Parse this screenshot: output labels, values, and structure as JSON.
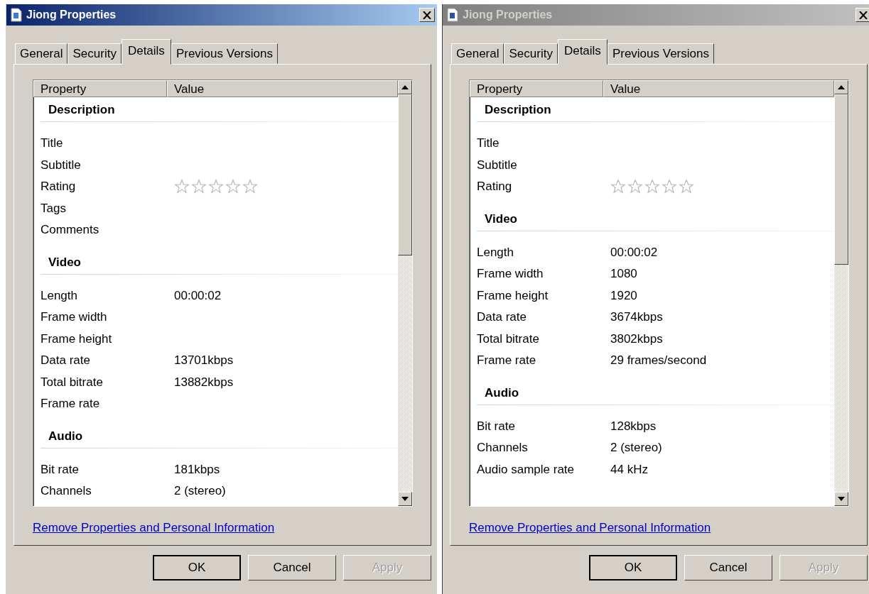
{
  "windows": [
    {
      "title": "Jiong Properties",
      "active": true,
      "tabs": [
        {
          "label": "General",
          "selected": false
        },
        {
          "label": "Security",
          "selected": false
        },
        {
          "label": "Details",
          "selected": true
        },
        {
          "label": "Previous Versions",
          "selected": false
        }
      ],
      "columns": [
        "Property",
        "Value"
      ],
      "sections": [
        {
          "heading": "Description",
          "rows": [
            {
              "kind": "text",
              "property": "Title"
            },
            {
              "kind": "text",
              "property": "Subtitle"
            },
            {
              "kind": "rating",
              "property": "Rating",
              "stars": 0
            },
            {
              "kind": "text",
              "property": "Tags"
            },
            {
              "kind": "text",
              "property": "Comments"
            }
          ]
        },
        {
          "heading": "Video",
          "rows": [
            {
              "kind": "text",
              "property": "Length",
              "value": "00:00:02"
            },
            {
              "kind": "text",
              "property": "Frame width"
            },
            {
              "kind": "text",
              "property": "Frame height"
            },
            {
              "kind": "text",
              "property": "Data rate",
              "value": "13701kbps"
            },
            {
              "kind": "text",
              "property": "Total bitrate",
              "value": "13882kbps"
            },
            {
              "kind": "text",
              "property": "Frame rate"
            }
          ]
        },
        {
          "heading": "Audio",
          "rows": [
            {
              "kind": "text",
              "property": "Bit rate",
              "value": "181kbps"
            },
            {
              "kind": "text",
              "property": "Channels",
              "value": "2 (stereo)"
            }
          ]
        }
      ],
      "link": "Remove Properties and Personal Information",
      "buttons": [
        {
          "label": "OK",
          "default": true,
          "disabled": false
        },
        {
          "label": "Cancel",
          "default": false,
          "disabled": false
        },
        {
          "label": "Apply",
          "default": false,
          "disabled": true
        }
      ]
    },
    {
      "title": "Jiong Properties",
      "active": false,
      "tabs": [
        {
          "label": "General",
          "selected": false
        },
        {
          "label": "Security",
          "selected": false
        },
        {
          "label": "Details",
          "selected": true
        },
        {
          "label": "Previous Versions",
          "selected": false
        }
      ],
      "columns": [
        "Property",
        "Value"
      ],
      "sections": [
        {
          "heading": "Description",
          "rows": [
            {
              "kind": "text",
              "property": "Title"
            },
            {
              "kind": "text",
              "property": "Subtitle"
            },
            {
              "kind": "rating",
              "property": "Rating",
              "stars": 0
            }
          ]
        },
        {
          "heading": "Video",
          "rows": [
            {
              "kind": "text",
              "property": "Length",
              "value": "00:00:02"
            },
            {
              "kind": "text",
              "property": "Frame width",
              "value": "1080"
            },
            {
              "kind": "text",
              "property": "Frame height",
              "value": "1920"
            },
            {
              "kind": "text",
              "property": "Data rate",
              "value": "3674kbps"
            },
            {
              "kind": "text",
              "property": "Total bitrate",
              "value": "3802kbps"
            },
            {
              "kind": "text",
              "property": "Frame rate",
              "value": "29 frames/second"
            }
          ]
        },
        {
          "heading": "Audio",
          "rows": [
            {
              "kind": "text",
              "property": "Bit rate",
              "value": "128kbps"
            },
            {
              "kind": "text",
              "property": "Channels",
              "value": "2 (stereo)"
            },
            {
              "kind": "text",
              "property": "Audio sample rate",
              "value": "44 kHz"
            }
          ]
        }
      ],
      "link": "Remove Properties and Personal Information",
      "buttons": [
        {
          "label": "OK",
          "default": true,
          "disabled": false
        },
        {
          "label": "Cancel",
          "default": false,
          "disabled": false
        },
        {
          "label": "Apply",
          "default": false,
          "disabled": true
        }
      ]
    }
  ]
}
